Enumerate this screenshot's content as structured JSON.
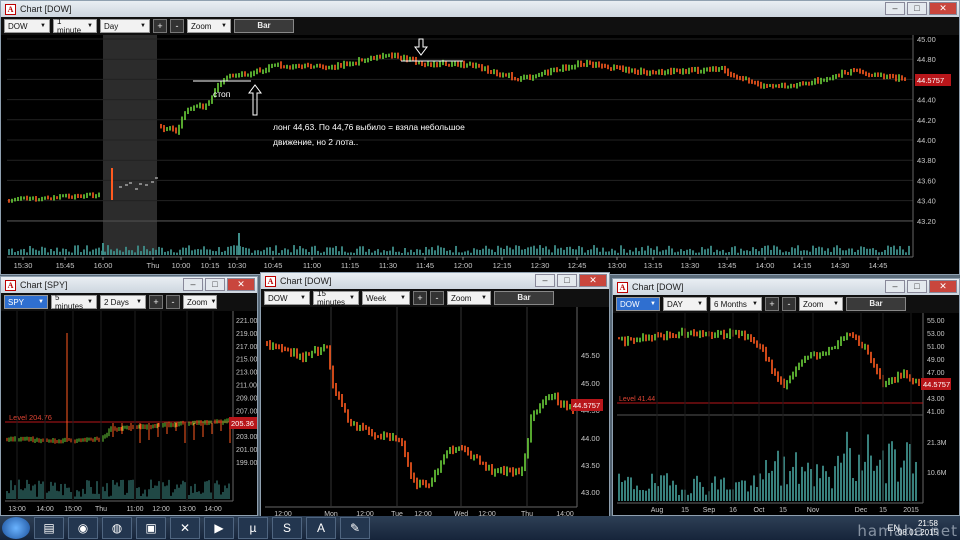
{
  "colors": {
    "up": "#6bd13a",
    "down": "#ff5a1f",
    "level": "#b8161a",
    "price_tag": "#b8161a",
    "axis": "#c8c8c8"
  },
  "main": {
    "title": "Chart [DOW]",
    "symbol": "DOW",
    "interval": "1 minute",
    "period": "Day",
    "zoom": "Zoom",
    "bar": "Bar",
    "price_tag": "44.5757",
    "yticks": [
      "45.00",
      "44.80",
      "44.60",
      "44.40",
      "44.20",
      "44.00",
      "43.80",
      "43.60",
      "43.40",
      "43.20"
    ],
    "xticks": [
      "15:30",
      "15:45",
      "16:00",
      "Thu",
      "10:00",
      "10:15",
      "10:30",
      "10:45",
      "11:00",
      "11:15",
      "11:30",
      "11:45",
      "12:00",
      "12:15",
      "12:30",
      "12:45",
      "13:00",
      "13:15",
      "13:30",
      "13:45",
      "14:00",
      "14:15",
      "14:30",
      "14:45"
    ],
    "annotation_stop": "стоп",
    "annotation_line1": "лонг 44,63. По 44,76 выбило = взяла небольшое",
    "annotation_line2": "движение, но 2 лота.."
  },
  "spy": {
    "title": "Chart [SPY]",
    "symbol": "SPY",
    "interval": "5 minutes",
    "period": "2 Days",
    "zoom": "Zoom",
    "bar": "Bar",
    "level_label": "Level 204.76",
    "price_tag": "205.36",
    "yticks": [
      "221.00",
      "219.00",
      "217.00",
      "215.00",
      "213.00",
      "211.00",
      "209.00",
      "207.00",
      "205.00",
      "203.00",
      "201.00",
      "199.00"
    ],
    "xticks": [
      "13:00",
      "14:00",
      "15:00",
      "Thu",
      "11:00",
      "12:00",
      "13:00",
      "14:00"
    ]
  },
  "dow15": {
    "title": "Chart [DOW]",
    "symbol": "DOW",
    "interval": "15 minutes",
    "period": "Week",
    "zoom": "Zoom",
    "bar": "Bar",
    "price_tag": "44.5757",
    "yticks": [
      "45.50",
      "45.00",
      "44.50",
      "44.00",
      "43.50",
      "43.00"
    ],
    "xticks": [
      "12:00",
      "Mon",
      "12:00",
      "Tue",
      "12:00",
      "Wed",
      "12:00",
      "Thu",
      "14:00"
    ]
  },
  "dowday": {
    "title": "Chart [DOW]",
    "symbol": "DOW",
    "interval": "DAY",
    "period": "6 Months",
    "zoom": "Zoom",
    "bar": "Bar",
    "level_label": "Level 41.44",
    "price_tag": "44.5757",
    "yticks": [
      "55.00",
      "53.00",
      "51.00",
      "49.00",
      "47.00",
      "45.00",
      "43.00",
      "41.00"
    ],
    "vol_ticks": [
      "21.3M",
      "10.6M"
    ],
    "xticks": [
      "Aug",
      "15",
      "Sep",
      "16",
      "Oct",
      "15",
      "Nov",
      "Dec",
      "15",
      "2015"
    ]
  },
  "taskbar": {
    "lang": "EN",
    "time": "21:58",
    "date": "08.01.2015",
    "watermark": "hamaha.net"
  }
}
